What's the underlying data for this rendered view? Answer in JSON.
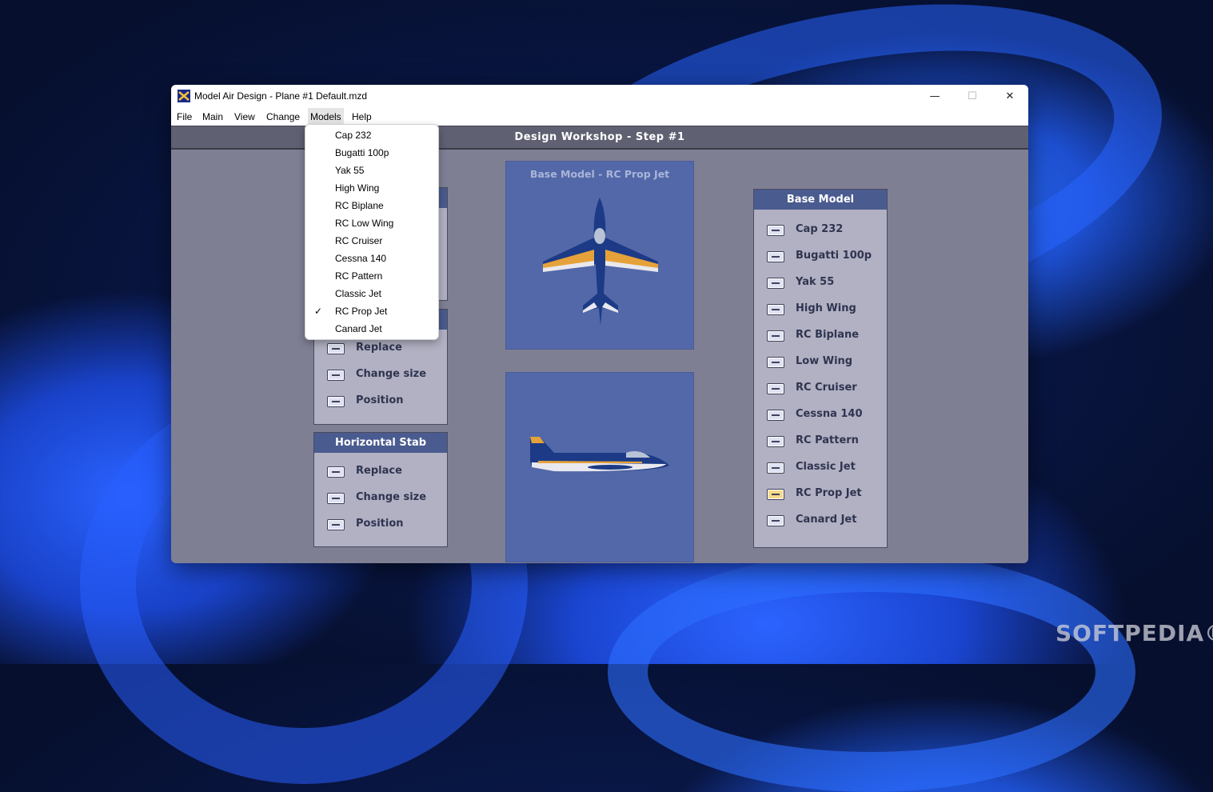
{
  "window": {
    "title": "Model Air Design - Plane #1  Default.mzd",
    "controls": {
      "minimize": "—",
      "maximize": "☐",
      "close": "✕"
    }
  },
  "menubar": [
    "File",
    "Main",
    "View",
    "Change",
    "Models",
    "Help"
  ],
  "step_title": "Design Workshop  -  Step #1",
  "models_menu": {
    "items": [
      "Cap 232",
      "Bugatti 100p",
      "Yak 55",
      "High Wing",
      "RC Biplane",
      "RC Low Wing",
      "RC Cruiser",
      "Cessna 140",
      "RC Pattern",
      "Classic Jet",
      "RC Prop Jet",
      "Canard Jet"
    ],
    "checked": "RC Prop Jet",
    "check_glyph": "✓"
  },
  "left_panel_1": {
    "options": [
      "Replace",
      "Change size",
      "Position"
    ]
  },
  "left_panel_2": {
    "title": "Horizontal Stab",
    "options": [
      "Replace",
      "Change size",
      "Position"
    ]
  },
  "top_view": {
    "title": "Base Model - RC Prop Jet"
  },
  "base_model_panel": {
    "title": "Base Model",
    "options": [
      "Cap 232",
      "Bugatti 100p",
      "Yak 55",
      "High Wing",
      "RC Biplane",
      "Low Wing",
      "RC Cruiser",
      "Cessna 140",
      "RC Pattern",
      "Classic Jet",
      "RC Prop Jet",
      "Canard Jet"
    ],
    "selected": "RC Prop Jet"
  },
  "watermark": "SOFTPEDIA®",
  "colors": {
    "panel_head": "#4a5b8f",
    "view_bg": "#5368a8",
    "selected_button": "#f7d98a",
    "window_bg": "#7f7f94"
  }
}
